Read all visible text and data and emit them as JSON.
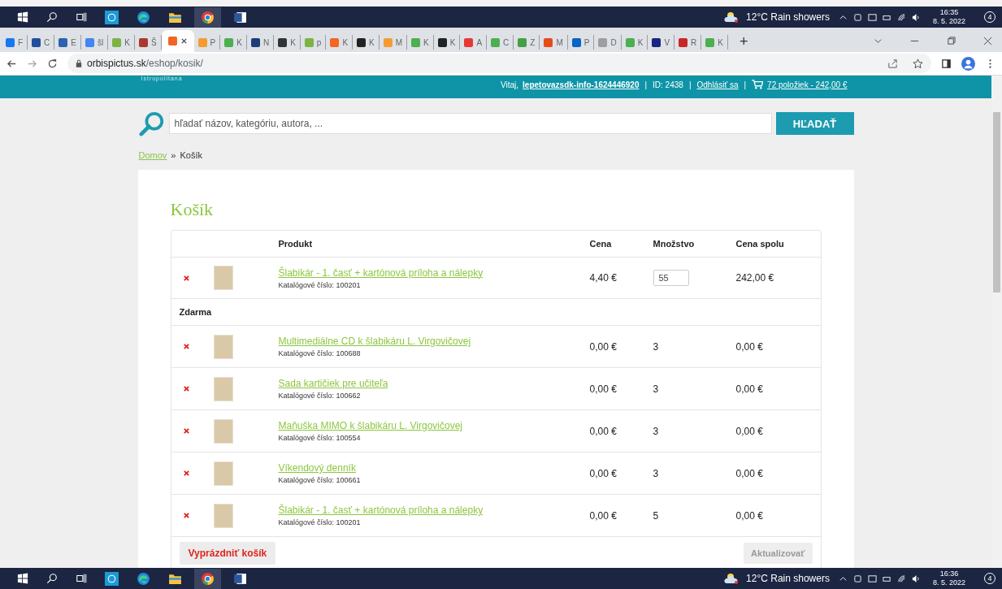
{
  "taskbar_top": {
    "weather": "12°C  Rain showers",
    "time": "16:35",
    "date": "8. 5. 2022",
    "notifications": "4"
  },
  "browser": {
    "tabs": [
      {
        "label": "F",
        "selected": false,
        "color": "#1877f2"
      },
      {
        "label": "C",
        "selected": false,
        "color": "#1f4e9c"
      },
      {
        "label": "E",
        "selected": false,
        "color": "#2a62b0"
      },
      {
        "label": "šl",
        "selected": false,
        "color": "#4285f4"
      },
      {
        "label": "K",
        "selected": false,
        "color": "#7cb342"
      },
      {
        "label": "Š",
        "selected": false,
        "color": "#a83a2c"
      },
      {
        "selected": true,
        "color": "#f26522"
      },
      {
        "label": "P",
        "selected": false,
        "color": "#f39c34"
      },
      {
        "label": "K",
        "selected": false,
        "color": "#4caf50"
      },
      {
        "label": "N",
        "selected": false,
        "color": "#1c3d7a"
      },
      {
        "label": "K",
        "selected": false,
        "color": "#333333"
      },
      {
        "label": "p",
        "selected": false,
        "color": "#7cb342"
      },
      {
        "label": "K",
        "selected": false,
        "color": "#f26522"
      },
      {
        "label": "K",
        "selected": false,
        "color": "#222222"
      },
      {
        "label": "M",
        "selected": false,
        "color": "#f39c34"
      },
      {
        "label": "K",
        "selected": false,
        "color": "#4caf50"
      },
      {
        "label": "K",
        "selected": false,
        "color": "#222222"
      },
      {
        "label": "A",
        "selected": false,
        "color": "#e53935"
      },
      {
        "label": "C",
        "selected": false,
        "color": "#4caf50"
      },
      {
        "label": "Z",
        "selected": false,
        "color": "#43a047"
      },
      {
        "label": "M",
        "selected": false,
        "color": "#e64a19"
      },
      {
        "label": "P",
        "selected": false,
        "color": "#0a64c8"
      },
      {
        "label": "D",
        "selected": false,
        "color": "#9e9e9e"
      },
      {
        "label": "K",
        "selected": false,
        "color": "#4caf50"
      },
      {
        "label": "V",
        "selected": false,
        "color": "#1a237e"
      },
      {
        "label": "R",
        "selected": false,
        "color": "#c62828"
      },
      {
        "label": "K",
        "selected": false,
        "color": "#4caf50"
      }
    ],
    "new_tab": "+",
    "address": {
      "host": "orbispictus.sk",
      "path": "/eshop/kosik/"
    }
  },
  "header": {
    "logo_text": "Istropolitana",
    "greeting": "Vitaj,",
    "separator": "|",
    "username": "lepetovazsdk-info-1624446920",
    "id": "ID: 2438",
    "logout": "Odhlásiť sa",
    "cart": "72 položiek - 242,00 €"
  },
  "search": {
    "placeholder": "hľadať názov, kategóriu, autora, ...",
    "button": "HĽADAŤ"
  },
  "breadcrumb": {
    "home": "Domov",
    "separator": "»",
    "current": "Košík"
  },
  "title": "Košík",
  "table": {
    "columns": [
      "Produkt",
      "Cena",
      "Množstvo",
      "Cena spolu"
    ],
    "rows": [
      {
        "kind": "product",
        "name": "Šlabikár - 1. časť + kartónová príloha a nálepky",
        "code": "Katalógové číslo: 100201",
        "price": "4,40 €",
        "quantity": "55",
        "quantity_editable": true,
        "total": "242,00 €"
      },
      {
        "kind": "section",
        "name": "Zdarma"
      },
      {
        "kind": "product",
        "name": "Multimediálne CD k šlabikáru L. Virgovičovej",
        "code": "Katalógové číslo: 100688",
        "price": "0,00 €",
        "quantity": "3",
        "quantity_editable": false,
        "total": "0,00 €"
      },
      {
        "kind": "product",
        "name": "Sada kartičiek pre učiteľa",
        "code": "Katalógové číslo: 100662",
        "price": "0,00 €",
        "quantity": "3",
        "quantity_editable": false,
        "total": "0,00 €"
      },
      {
        "kind": "product",
        "name": "Maňuška MIMO k šlabikáru L. Virgovičovej",
        "code": "Katalógové číslo: 100554",
        "price": "0,00 €",
        "quantity": "3",
        "quantity_editable": false,
        "total": "0,00 €"
      },
      {
        "kind": "product",
        "name": "Víkendový denník",
        "code": "Katalógové číslo: 100661",
        "price": "0,00 €",
        "quantity": "3",
        "quantity_editable": false,
        "total": "0,00 €"
      },
      {
        "kind": "product",
        "name": "Šlabikár - 1. časť + kartónová príloha a nálepky",
        "code": "Katalógové číslo: 100201",
        "price": "0,00 €",
        "quantity": "5",
        "quantity_editable": false,
        "total": "0,00 €"
      }
    ],
    "empty_button": "Vyprázdniť košík",
    "update_button": {
      "label": "Aktualizovať",
      "disabled": true
    }
  },
  "taskbar_bottom": {
    "weather": "12°C  Rain showers",
    "time": "16:36",
    "date": "8. 5. 2022",
    "notifications": "4"
  }
}
